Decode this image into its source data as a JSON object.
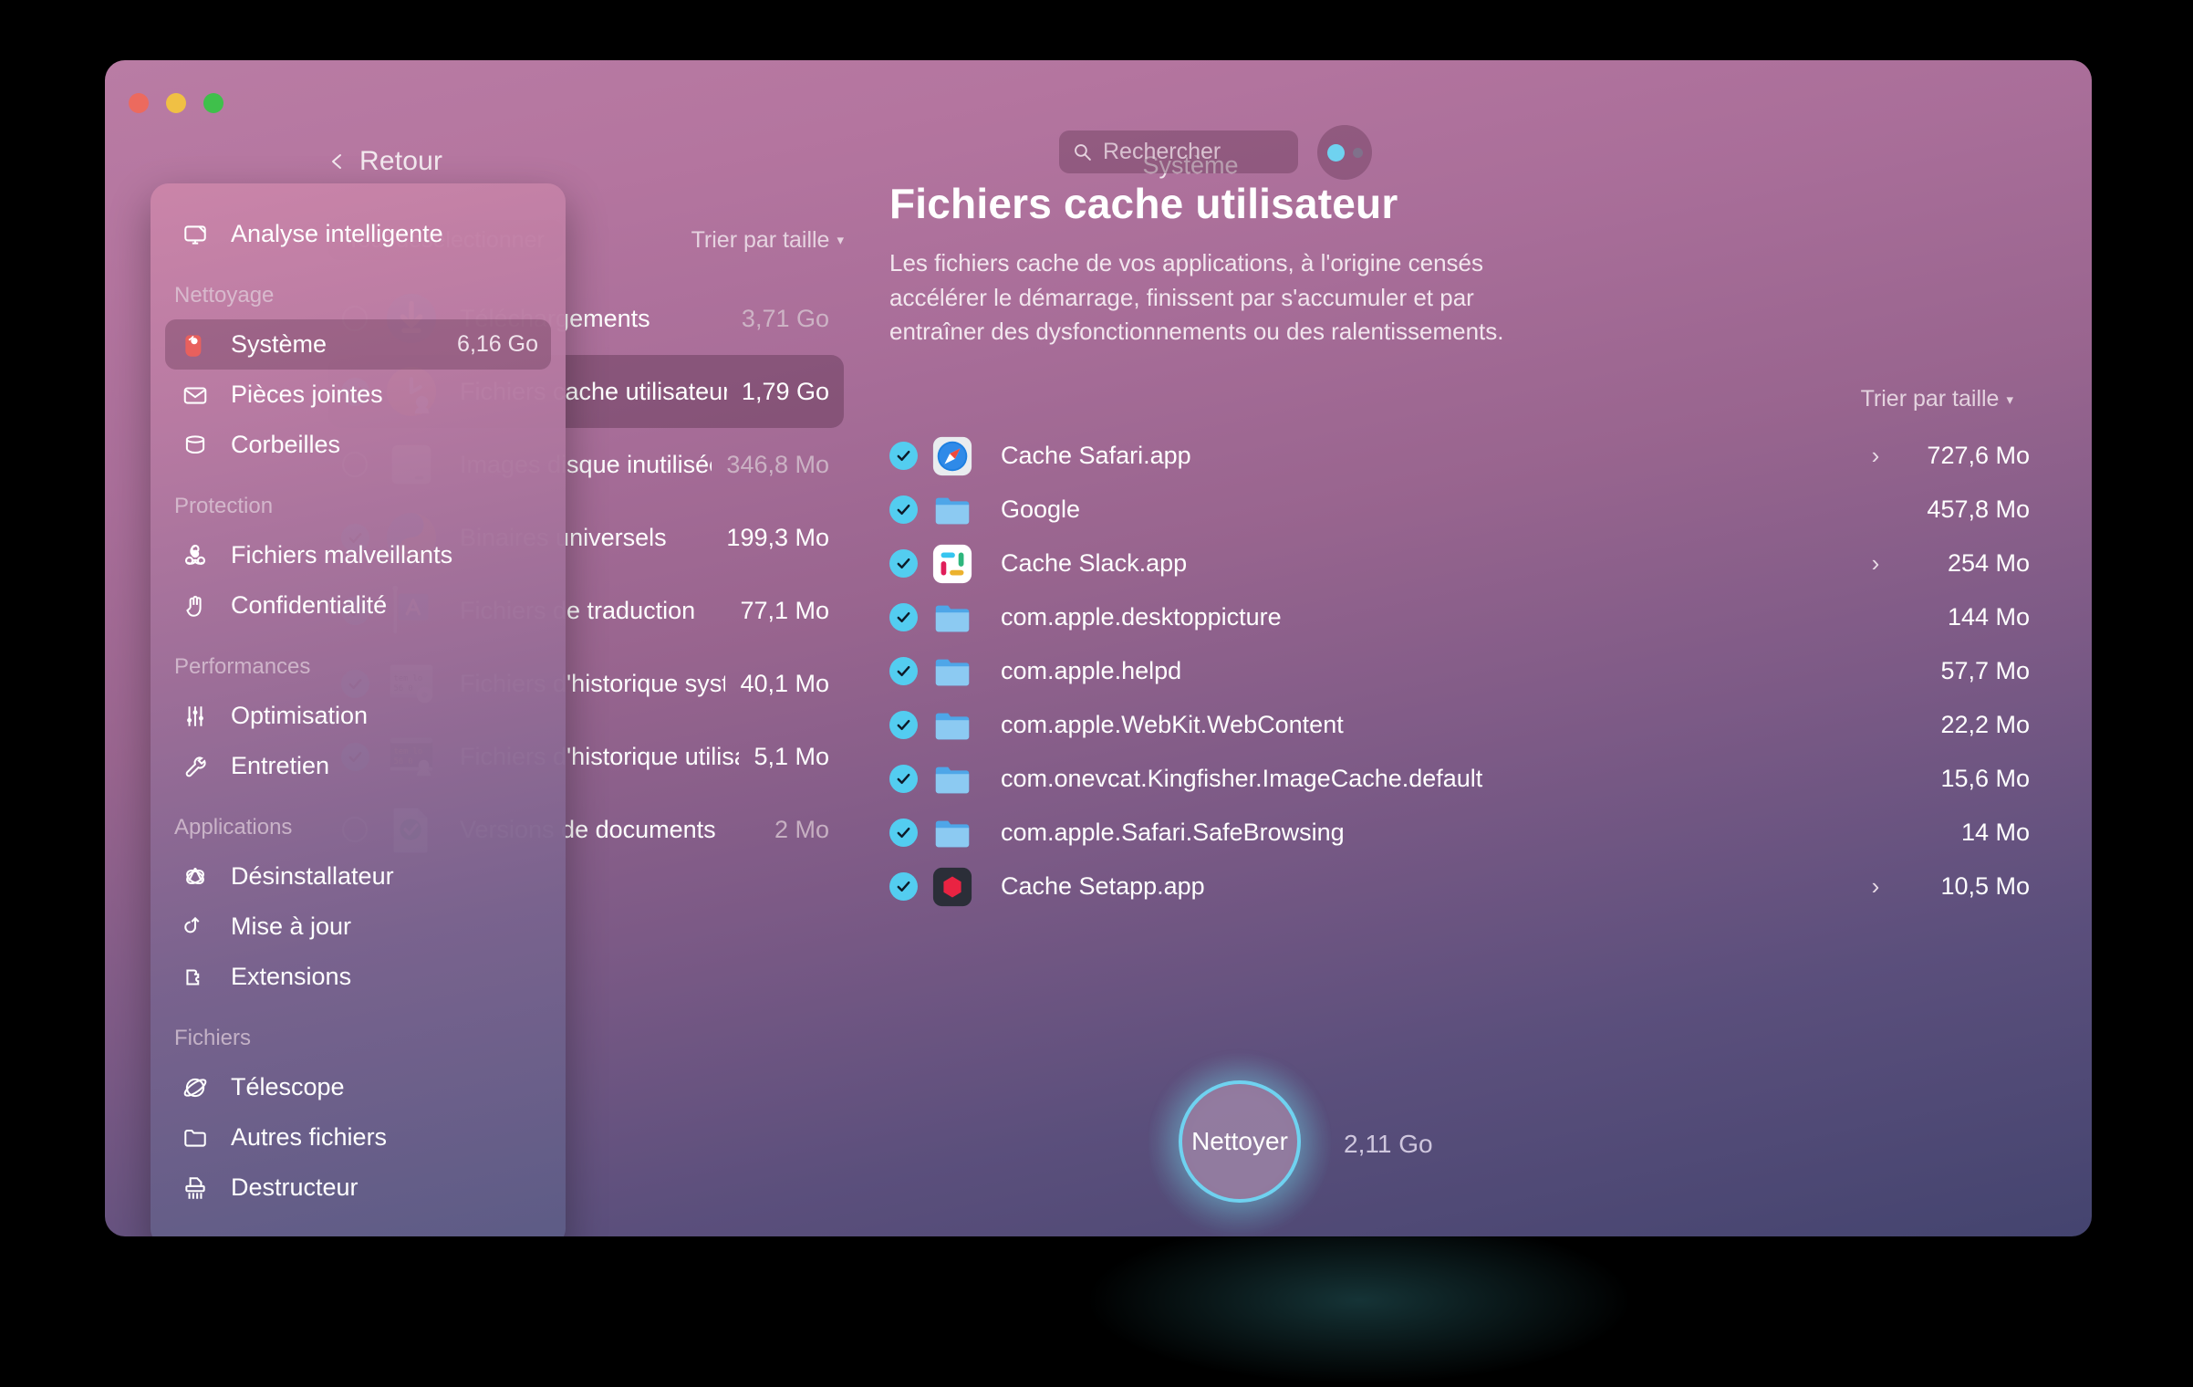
{
  "window": {
    "traffic_lights": [
      "close",
      "minimize",
      "zoom"
    ],
    "colors": {
      "accent_cyan": "#6fd2f0",
      "top_bg": "#b97ca4",
      "bottom_bg": "#44446f",
      "check_blue": "#53cdf0"
    }
  },
  "topbar": {
    "back_label": "Retour",
    "center_title": "Système",
    "search_placeholder": "Rechercher"
  },
  "sidebar": {
    "top_item": {
      "label": "Analyse intelligente",
      "icon": "smart-scan-icon"
    },
    "groups": [
      {
        "title": "Nettoyage",
        "items": [
          {
            "label": "Système",
            "value": "6,16 Go",
            "icon": "tag-icon",
            "active": true
          },
          {
            "label": "Pièces jointes",
            "value": "",
            "icon": "mail-icon",
            "active": false
          },
          {
            "label": "Corbeilles",
            "value": "",
            "icon": "trash-bin-icon",
            "active": false
          }
        ]
      },
      {
        "title": "Protection",
        "items": [
          {
            "label": "Fichiers malveillants",
            "value": "",
            "icon": "biohazard-icon",
            "active": false
          },
          {
            "label": "Confidentialité",
            "value": "",
            "icon": "hand-icon",
            "active": false
          }
        ]
      },
      {
        "title": "Performances",
        "items": [
          {
            "label": "Optimisation",
            "value": "",
            "icon": "sliders-icon",
            "active": false
          },
          {
            "label": "Entretien",
            "value": "",
            "icon": "wrench-icon",
            "active": false
          }
        ]
      },
      {
        "title": "Applications",
        "items": [
          {
            "label": "Désinstallateur",
            "value": "",
            "icon": "appstore-icon",
            "active": false
          },
          {
            "label": "Mise à jour",
            "value": "",
            "icon": "update-arrow-icon",
            "active": false
          },
          {
            "label": "Extensions",
            "value": "",
            "icon": "puzzle-icon",
            "active": false
          }
        ]
      },
      {
        "title": "Fichiers",
        "items": [
          {
            "label": "Télescope",
            "value": "",
            "icon": "planet-icon",
            "active": false
          },
          {
            "label": "Autres fichiers",
            "value": "",
            "icon": "folder-icon",
            "active": false
          },
          {
            "label": "Destructeur",
            "value": "",
            "icon": "shredder-icon",
            "active": false
          }
        ]
      }
    ]
  },
  "middle": {
    "deselect_all_label": "Tout désélectionner",
    "sort_label": "Trier par taille",
    "sort_caret": "▾",
    "rows": [
      {
        "name": "Téléchargements",
        "size": "3,71 Go",
        "checked": false,
        "selected": false,
        "icon": "downloads-icon"
      },
      {
        "name": "Fichiers cache utilisateur",
        "size": "1,79 Go",
        "checked": true,
        "selected": true,
        "icon": "user-cache-icon"
      },
      {
        "name": "Images disque inutilisées",
        "size": "346,8 Mo",
        "checked": false,
        "selected": false,
        "icon": "disk-image-icon"
      },
      {
        "name": "Binaires universels",
        "size": "199,3 Mo",
        "checked": true,
        "selected": false,
        "icon": "universal-binaries-icon"
      },
      {
        "name": "Fichiers de traduction",
        "size": "77,1 Mo",
        "checked": true,
        "selected": false,
        "icon": "language-files-icon"
      },
      {
        "name": "Fichiers d'historique systè…",
        "size": "40,1 Mo",
        "checked": true,
        "selected": false,
        "icon": "system-logs-icon"
      },
      {
        "name": "Fichiers d'historique utilisat…",
        "size": "5,1 Mo",
        "checked": true,
        "selected": false,
        "icon": "user-logs-icon"
      },
      {
        "name": "Versions de documents",
        "size": "2 Mo",
        "checked": false,
        "selected": false,
        "icon": "document-versions-icon"
      }
    ]
  },
  "detail": {
    "title": "Fichiers cache utilisateur",
    "description": "Les fichiers cache de vos applications, à l'origine censés accélérer le démarrage, finissent par s'accumuler et par entraîner des dysfonctionnements ou des ralentissements.",
    "sort_label": "Trier par taille",
    "sort_caret": "▾",
    "rows": [
      {
        "name": "Cache Safari.app",
        "size": "727,6 Mo",
        "checked": true,
        "expandable": true,
        "icon": "safari-icon"
      },
      {
        "name": "Google",
        "size": "457,8 Mo",
        "checked": true,
        "expandable": false,
        "icon": "folder-icon"
      },
      {
        "name": "Cache Slack.app",
        "size": "254 Mo",
        "checked": true,
        "expandable": true,
        "icon": "slack-icon"
      },
      {
        "name": "com.apple.desktoppicture",
        "size": "144 Mo",
        "checked": true,
        "expandable": false,
        "icon": "folder-icon"
      },
      {
        "name": "com.apple.helpd",
        "size": "57,7 Mo",
        "checked": true,
        "expandable": false,
        "icon": "folder-icon"
      },
      {
        "name": "com.apple.WebKit.WebContent",
        "size": "22,2 Mo",
        "checked": true,
        "expandable": false,
        "icon": "folder-icon"
      },
      {
        "name": "com.onevcat.Kingfisher.ImageCache.default",
        "size": "15,6 Mo",
        "checked": true,
        "expandable": false,
        "icon": "folder-icon"
      },
      {
        "name": "com.apple.Safari.SafeBrowsing",
        "size": "14 Mo",
        "checked": true,
        "expandable": false,
        "icon": "folder-icon"
      },
      {
        "name": "Cache Setapp.app",
        "size": "10,5 Mo",
        "checked": true,
        "expandable": true,
        "icon": "setapp-icon"
      }
    ]
  },
  "clean": {
    "button_label": "Nettoyer",
    "total_size": "2,11 Go"
  }
}
